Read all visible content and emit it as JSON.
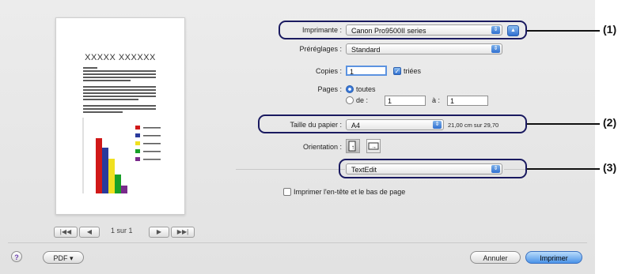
{
  "preview": {
    "doc_title": "XXXXX XXXXXX",
    "page_indicator": "1 sur 1",
    "nav_first": "|◀◀",
    "nav_prev": "◀",
    "nav_next": "▶",
    "nav_last": "▶▶|",
    "chart_data": {
      "type": "bar",
      "values": [
        70,
        58,
        44,
        24,
        10
      ],
      "colors": [
        "#d01818",
        "#2a3a9c",
        "#f0e020",
        "#18a028",
        "#7a2a8c"
      ]
    }
  },
  "form": {
    "printer_label": "Imprimante :",
    "printer_value": "Canon Pro9500II series",
    "presets_label": "Préréglages :",
    "presets_value": "Standard",
    "copies_label": "Copies :",
    "copies_value": "1",
    "collated_label": "triées",
    "pages_label": "Pages :",
    "pages_all": "toutes",
    "pages_from": "de :",
    "pages_from_value": "1",
    "pages_to": "à :",
    "pages_to_value": "1",
    "paper_label": "Taille du papier :",
    "paper_value": "A4",
    "paper_size_text": "21,00 cm sur 29,70",
    "orientation_label": "Orientation :",
    "app_menu_value": "TextEdit",
    "header_footer_label": "Imprimer l'en-tête et le bas de page"
  },
  "callouts": [
    "(1)",
    "(2)",
    "(3)"
  ],
  "footer": {
    "help": "?",
    "pdf": "PDF ▾",
    "cancel": "Annuler",
    "print": "Imprimer"
  },
  "colors": {
    "callout_border": "#1a1a60",
    "accent": "#2f6fd0"
  }
}
